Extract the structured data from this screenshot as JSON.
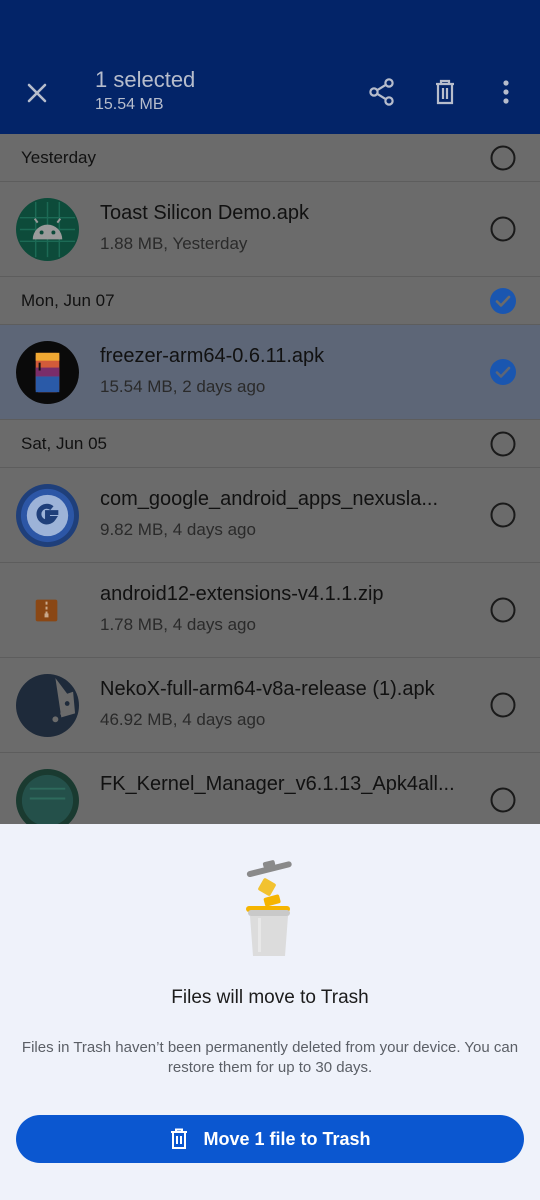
{
  "topbar": {
    "title": "1 selected",
    "subtitle": "15.54 MB",
    "icons": [
      "close-icon",
      "share-icon",
      "trash-icon",
      "more-vert-icon"
    ]
  },
  "groups": [
    {
      "date": "Yesterday",
      "header_checked": false,
      "files": [
        {
          "name": "Toast Silicon Demo.apk",
          "meta": "1.88 MB, Yesterday",
          "checked": false,
          "icon": "android-icon"
        }
      ]
    },
    {
      "date": "Mon, Jun 07",
      "header_checked": true,
      "files": [
        {
          "name": "freezer-arm64-0.6.11.apk",
          "meta": "15.54 MB, 2 days ago",
          "checked": true,
          "icon": "freezer-app-icon"
        }
      ]
    },
    {
      "date": "Sat, Jun 05",
      "header_checked": false,
      "files": [
        {
          "name": "com_google_android_apps_nexusla...",
          "meta": "9.82 MB, 4 days ago",
          "checked": false,
          "icon": "google-g-icon"
        },
        {
          "name": "android12-extensions-v4.1.1.zip",
          "meta": "1.78 MB, 4 days ago",
          "checked": false,
          "icon": "zip-file-icon"
        },
        {
          "name": "NekoX-full-arm64-v8a-release (1).apk",
          "meta": "46.92 MB, 4 days ago",
          "checked": false,
          "icon": "nekox-icon"
        },
        {
          "name": "FK_Kernel_Manager_v6.1.13_Apk4all...",
          "meta": "",
          "checked": false,
          "icon": "fk-kernel-icon"
        }
      ]
    }
  ],
  "sheet": {
    "illustration": "trash-can-illustration",
    "heading": "Files will move to Trash",
    "body": "Files in Trash haven’t been permanently deleted from your device. You can restore them for up to 30 days.",
    "button_label": "Move 1 file to Trash",
    "button_icon": "trash-icon"
  },
  "colors": {
    "topbar": "#032468",
    "accent": "#0b57d0",
    "sheet_bg": "#eff2fa",
    "check_selected": "#1a56b0"
  }
}
